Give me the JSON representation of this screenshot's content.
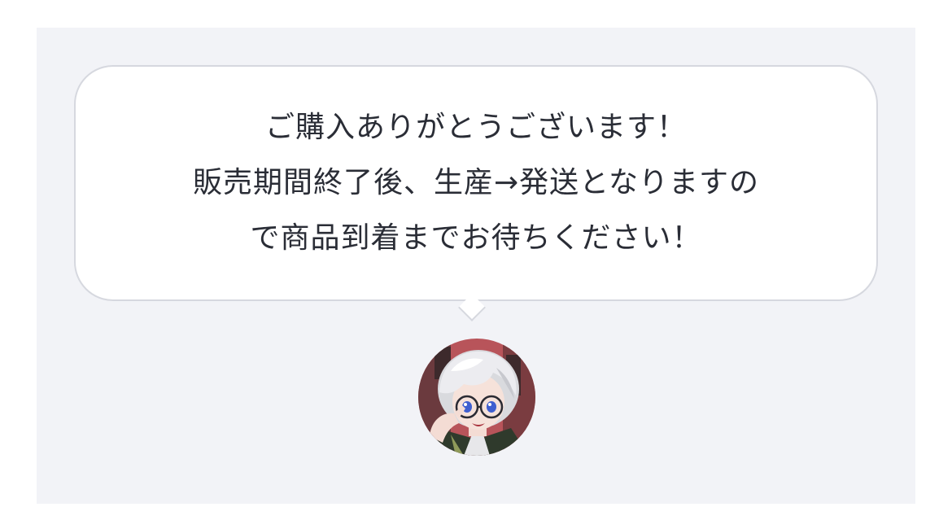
{
  "message": {
    "line1": "ご購入ありがとうございます！",
    "line2": "販売期間終了後、生産→発送となりますの",
    "line3": "で商品到着までお待ちください！"
  },
  "avatar": {
    "icon": "character-avatar-icon"
  }
}
